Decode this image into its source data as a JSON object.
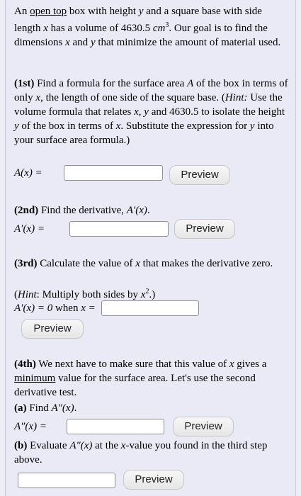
{
  "intro": {
    "t1": "An ",
    "open_top": "open top",
    "t2": " box with height ",
    "y": "y",
    "t3": " and a square base with side length ",
    "x": "x",
    "t4": " has a volume of ",
    "volume": "4630.5",
    "unit": "cm",
    "exp": "3",
    "t5": ". Our goal is to find the dimensions ",
    "t6": " and ",
    "t7": " that minimize the amount of material used."
  },
  "step1": {
    "tag": "(1st)",
    "t1": " Find a formula for the surface area ",
    "A": "A",
    "t2": " of the box in terms of only ",
    "t3": ", the length of one side of the square base. (",
    "hint": "Hint:",
    "t4": " Use the volume formula that relates ",
    "t5": " and ",
    "volume": "4630.5",
    "t6": " to isolate the height ",
    "t7": " of the box in terms of ",
    "t8": ". Substitute the expression for ",
    "t9": " into your surface area formula.)",
    "label": "A(x) =",
    "preview": "Preview"
  },
  "step2": {
    "tag": "(2nd)",
    "t1": " Find the derivative, ",
    "deriv": "A′(x)",
    "t2": ".",
    "label": "A′(x) =",
    "preview": "Preview"
  },
  "step3": {
    "tag": "(3rd)",
    "t1": " Calculate the value of ",
    "t2": " that makes the derivative zero.",
    "hint": "Hint",
    "t3": ": Multiply both sides by ",
    "x2": "x",
    "exp": "2",
    "t4": ".)",
    "label_a": "A′(x) = 0",
    "label_when": " when ",
    "label_b": "x =",
    "preview": "Preview"
  },
  "step4": {
    "tag": "(4th)",
    "t1": " We next have to make sure that this value of ",
    "t2": " gives a ",
    "minimum": "minimum",
    "t3": " value for the surface area. Let's use the second derivative test.",
    "a_tag": "(a)",
    "a_text": " Find ",
    "a_expr": "A″(x)",
    "a_end": ".",
    "a_label": "A″(x) =",
    "a_preview": "Preview",
    "b_tag": "(b)",
    "b_t1": " Evaluate ",
    "b_expr": "A″(x)",
    "b_t2": " at the ",
    "b_t3": "-value you found in the third step above.",
    "b_preview": "Preview"
  }
}
